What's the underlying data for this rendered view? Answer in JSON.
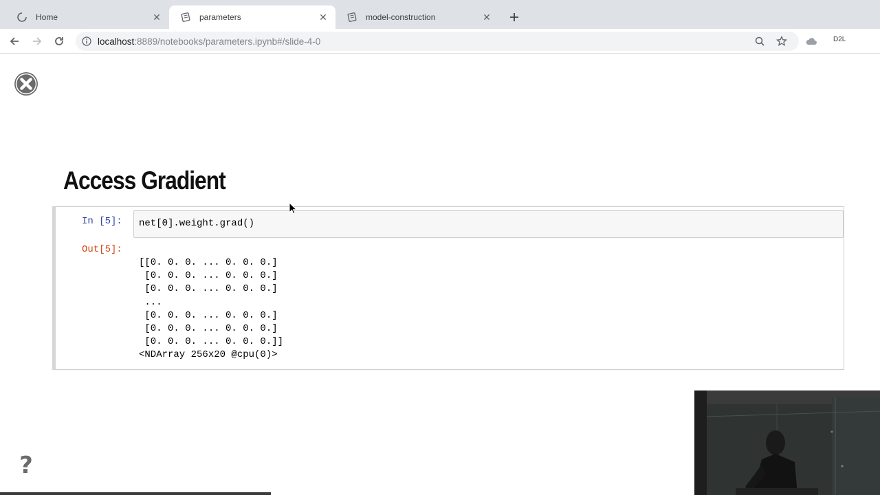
{
  "browser": {
    "tabs": [
      {
        "label": "Home",
        "active": false,
        "icon": "spinner-icon"
      },
      {
        "label": "parameters",
        "active": true,
        "icon": "notebook-icon"
      },
      {
        "label": "model-construction",
        "active": false,
        "icon": "notebook-icon"
      }
    ],
    "url": {
      "host": "localhost",
      "rest": ":8889/notebooks/parameters.ipynb#/slide-4-0"
    },
    "extension_badge": "D2L"
  },
  "slide": {
    "title": "Access Gradient",
    "help_glyph": "?",
    "cell": {
      "in_prompt": "In [5]:",
      "code": "net[0].weight.grad()",
      "out_prompt": "Out[5]:",
      "output": "[[0. 0. 0. ... 0. 0. 0.]\n [0. 0. 0. ... 0. 0. 0.]\n [0. 0. 0. ... 0. 0. 0.]\n ...\n [0. 0. 0. ... 0. 0. 0.]\n [0. 0. 0. ... 0. 0. 0.]\n [0. 0. 0. ... 0. 0. 0.]]\n<NDArray 256x20 @cpu(0)>"
    }
  },
  "colors": {
    "tabstrip": "#dee1e6",
    "prompt_in": "#303f9f",
    "prompt_out": "#d84315"
  }
}
